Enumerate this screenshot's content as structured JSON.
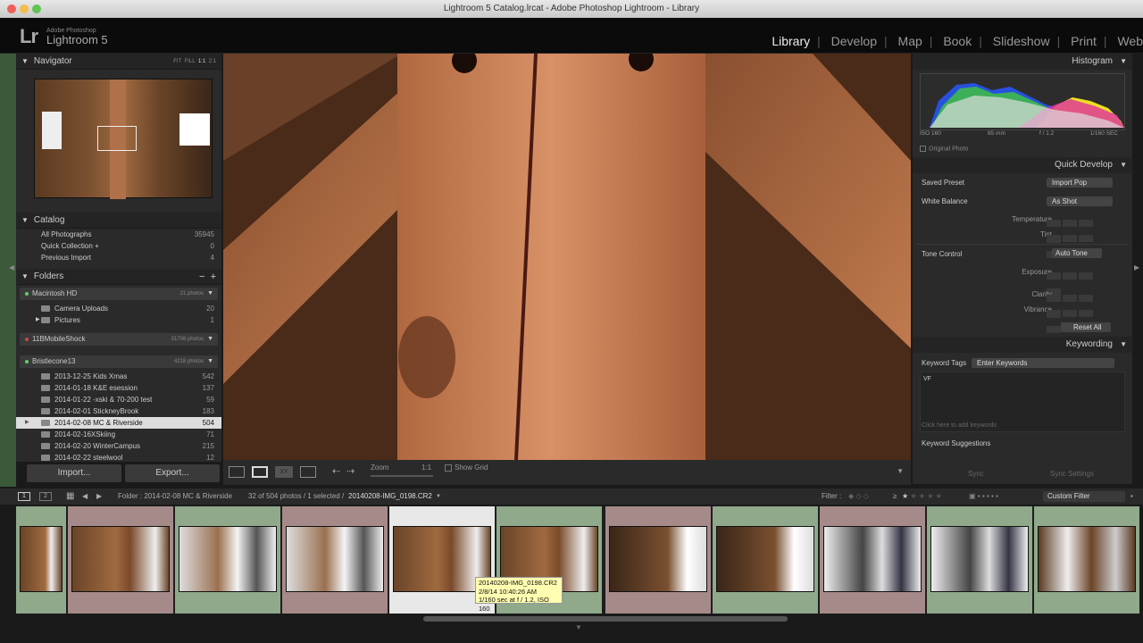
{
  "window": {
    "title": "Lightroom 5 Catalog.lrcat - Adobe Photoshop Lightroom - Library"
  },
  "logo": {
    "mark": "Lr",
    "sub": "Adobe Photoshop",
    "name": "Lightroom 5"
  },
  "modules": [
    {
      "label": "Library",
      "active": true
    },
    {
      "label": "Develop"
    },
    {
      "label": "Map"
    },
    {
      "label": "Book"
    },
    {
      "label": "Slideshow"
    },
    {
      "label": "Print"
    },
    {
      "label": "Web"
    }
  ],
  "navigator": {
    "title": "Navigator",
    "modes": [
      "FIT",
      "FILL",
      "1:1",
      "2:1"
    ]
  },
  "catalog": {
    "title": "Catalog",
    "items": [
      {
        "label": "All Photographs",
        "count": "35945"
      },
      {
        "label": "Quick Collection +",
        "count": "0"
      },
      {
        "label": "Previous Import",
        "count": "4"
      }
    ]
  },
  "folders": {
    "title": "Folders",
    "volumes": [
      {
        "name": "Macintosh HD",
        "info": "21 photos",
        "folders": [
          {
            "label": "Camera Uploads",
            "count": "20"
          },
          {
            "label": "Pictures",
            "count": "1"
          }
        ]
      },
      {
        "name": "11BMobileShock",
        "info": "31706 photos",
        "folders": []
      },
      {
        "name": "Bristlecone13",
        "info": "4218 photos",
        "folders": [
          {
            "label": "2013-12-25 Kids Xmas",
            "count": "542"
          },
          {
            "label": "2014-01-18 K&E esession",
            "count": "137"
          },
          {
            "label": "2014-01-22 -xski & 70-200 test",
            "count": "59"
          },
          {
            "label": "2014-02-01 StickneyBrook",
            "count": "183"
          },
          {
            "label": "2014-02-08 MC & Riverside",
            "count": "504",
            "selected": true
          },
          {
            "label": "2014-02-16XSkiing",
            "count": "71"
          },
          {
            "label": "2014-02-20 WinterCampus",
            "count": "215"
          },
          {
            "label": "2014-02-22 steelwool",
            "count": "12"
          }
        ]
      }
    ]
  },
  "buttons": {
    "import": "Import...",
    "export": "Export..."
  },
  "toolbar": {
    "zoom_label": "Zoom",
    "zoom_value": "1:1",
    "show_grid": "Show Grid"
  },
  "histogram": {
    "title": "Histogram",
    "iso": "ISO 160",
    "focal": "85 mm",
    "aperture": "f / 1.2",
    "shutter": "1/160 SEC",
    "original_photo": "Original Photo"
  },
  "quick_develop": {
    "title": "Quick Develop",
    "saved_preset_label": "Saved Preset",
    "saved_preset_value": "Import Pop",
    "white_balance_label": "White Balance",
    "white_balance_value": "As Shot",
    "temperature": "Temperature",
    "tint": "Tint",
    "tone_control": "Tone Control",
    "auto_tone": "Auto Tone",
    "exposure": "Exposure",
    "clarity": "Clarity",
    "vibrance": "Vibrance",
    "reset_all": "Reset All"
  },
  "keywording": {
    "title": "Keywording",
    "tags_label": "Keyword Tags",
    "tags_value": "Enter Keywords",
    "keywords": "VF",
    "placeholder": "Click here to add keywords",
    "suggestions": "Keyword Suggestions"
  },
  "sync": {
    "sync": "Sync",
    "sync_settings": "Sync Settings"
  },
  "filterbar": {
    "pages": [
      "1",
      "2"
    ],
    "folder_path": "Folder : 2014-02-08 MC & Riverside",
    "counts": "32 of 504 photos / 1 selected /",
    "filename": "20140208-IMG_0198.CR2",
    "filter_label": "Filter :",
    "rating_op": "≥",
    "custom_filter": "Custom Filter"
  },
  "tooltip": {
    "line1": "20140208-IMG_0198.CR2",
    "line2": "2/8/14 10:40:26 AM",
    "line3": "1/160 sec at f / 1.2, ISO 160"
  },
  "colors": {
    "accent": "#eeeeee",
    "panel": "#2a2a2a",
    "selected_folder": "#dddddd",
    "tooltip": "#fefdb0"
  }
}
